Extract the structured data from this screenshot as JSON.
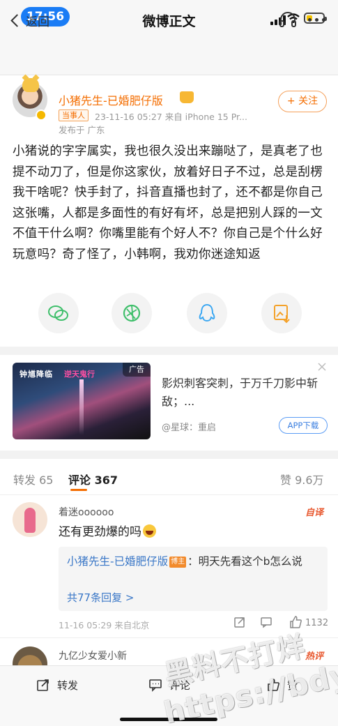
{
  "status_bar": {
    "time": "17:56"
  },
  "nav": {
    "back_label": "返回",
    "title": "微博正文"
  },
  "post": {
    "author": "小猪先生-已婚肥仔版",
    "role_tag": "当事人",
    "meta": "23-11-16 05:27  来自 iPhone 15 Pr...",
    "location": "发布于 广东",
    "follow_label": "+ 关注",
    "text": "小猪说的字字属实，我也很久没出来蹦哒了，是真老了也提不动刀了，但是你这家伙，放着好日子不过，总是刮楞我干啥呢？快手封了，抖音直播也封了，还不都是你自己这张嘴，人都是多面性的有好有坏，总是把别人踩的一文不值干什么啊？你嘴里能有个好人不？你自己是个什么好玩意吗？奇了怪了，小韩啊，我劝你迷途知返"
  },
  "share": [
    "wechat-icon",
    "moments-icon",
    "qq-icon",
    "save-image-icon"
  ],
  "ad": {
    "tag": "广告",
    "image_logo_white": "钟馗降临",
    "image_logo_pink": "逆天鬼行",
    "headline": "影炽刺客突刺，于万千刀影中斩敌；...",
    "source": "@星球：重启",
    "cta": "APP下载"
  },
  "tabs": {
    "repost": "转发 65",
    "comment": "评论 367",
    "like": "赞 9.6万"
  },
  "comments": [
    {
      "name": "着迷oooooo",
      "badge": "自译",
      "text": "还有更劲爆的吗",
      "reply_author": "小猪先生-已婚肥仔版",
      "reply_tag": "博主",
      "reply_text": "：明天先看这个b怎么说",
      "reply_count": "共77条回复 >",
      "meta": "11-16 05:29  来自北京",
      "likes": "1132"
    },
    {
      "name": "九亿少女爱小新",
      "badge": "热评"
    }
  ],
  "bottom_bar": {
    "repost": "转发",
    "comment": "评论",
    "like": "赞"
  },
  "watermark": {
    "line1": "黑料不打烊",
    "line2": "https://bdyz.co"
  },
  "colors": {
    "accent": "#f46d00",
    "link": "#3a77c7",
    "status_pill": "#1a7cf5"
  }
}
